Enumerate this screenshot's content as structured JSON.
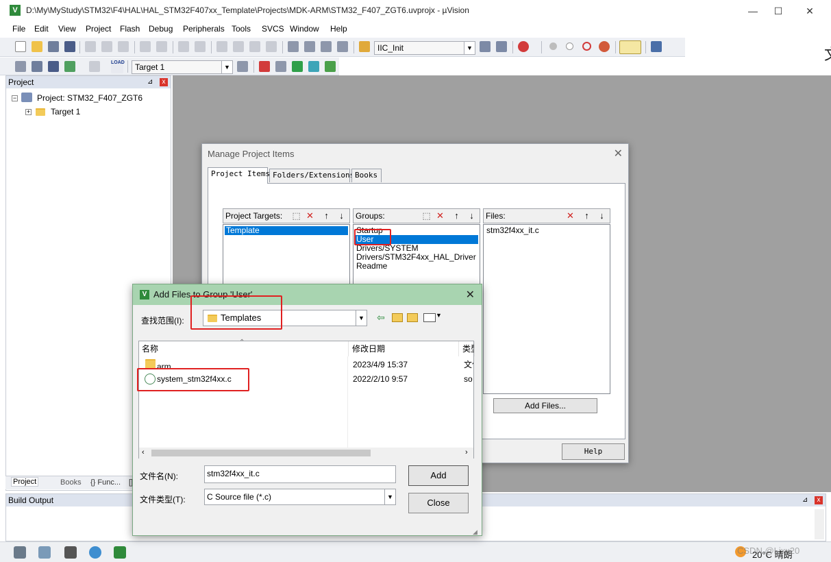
{
  "window": {
    "title": "D:\\My\\MyStudy\\STM32\\F4\\HAL\\HAL_STM32F407xx_Template\\Projects\\MDK-ARM\\STM32_F407_ZGT6.uvprojx - µVision",
    "app_icon_letter": "V",
    "minimize": "—",
    "maximize": "☐",
    "close": "✕"
  },
  "menu": [
    "File",
    "Edit",
    "View",
    "Project",
    "Flash",
    "Debug",
    "Peripherals",
    "Tools",
    "SVCS",
    "Window",
    "Help"
  ],
  "toolbar": {
    "function_combo": "IIC_Init",
    "target_combo": "Target 1",
    "load_label": "LOAD"
  },
  "project_panel": {
    "header": "Project",
    "pin": "⊿",
    "close": "x",
    "root": "Project: STM32_F407_ZGT6",
    "child": "Target 1",
    "tabs": [
      "Project",
      "Books",
      "{} Func...",
      "[]"
    ]
  },
  "build_output": {
    "header": "Build Output",
    "pin": "⊿",
    "close": "x"
  },
  "manage_dialog": {
    "title": "Manage Project Items",
    "close": "✕",
    "tabs": [
      "Project Items",
      "Folders/Extensions",
      "Books"
    ],
    "targets_label": "Project Targets:",
    "targets": [
      "Template"
    ],
    "groups_label": "Groups:",
    "groups": [
      "Startup",
      "User",
      "Drivers/SYSTEM",
      "Drivers/STM32F4xx_HAL_Driver",
      "Readme"
    ],
    "selected_group": "User",
    "files_label": "Files:",
    "files": [
      "stm32f4xx_it.c"
    ],
    "add_files_button": "Add Files...",
    "help_button": "Help"
  },
  "add_files_dialog": {
    "title": "Add Files to Group 'User'",
    "close": "✕",
    "look_in_label": "查找范围(I):",
    "look_in_value": "Templates",
    "columns": [
      "名称",
      "修改日期",
      "类型"
    ],
    "rows": [
      {
        "name": "arm",
        "date": "2023/4/9 15:37",
        "type": "文件夹"
      },
      {
        "name": "system_stm32f4xx.c",
        "date": "2022/2/10 9:57",
        "type": "so"
      }
    ],
    "filename_label": "文件名(N):",
    "filename_value": "stm32f4xx_it.c",
    "filetype_label": "文件类型(T):",
    "filetype_value": "C Source file (*.c)",
    "add_button": "Add",
    "close_button": "Close"
  },
  "taskbar": {
    "weather": "20°C 晴朗",
    "watermark": "CSDN @Ljxx20"
  },
  "colors": {
    "accent": "#0078d7",
    "highlight": "#e02020",
    "dialog_title": "#a8d4b0",
    "workspace": "#a0a0a0"
  }
}
